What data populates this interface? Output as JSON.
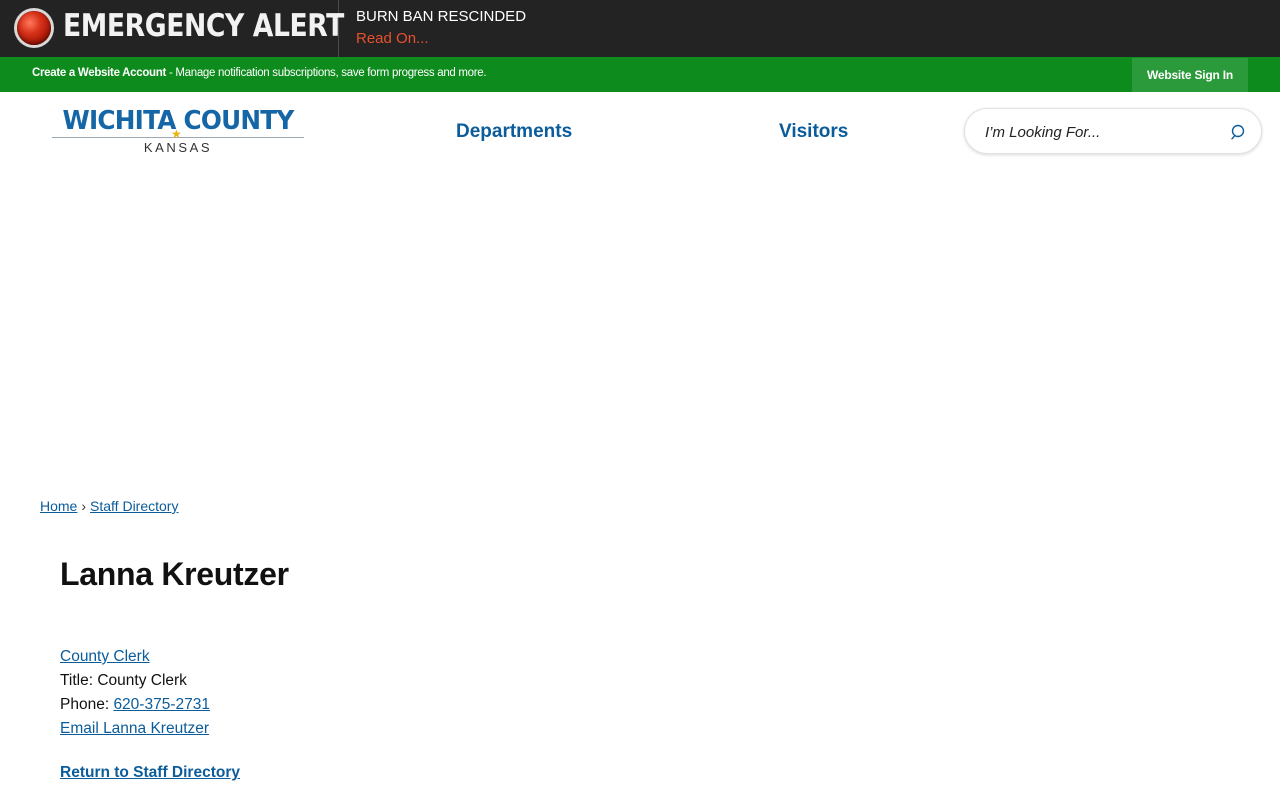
{
  "alert": {
    "title": "EMERGENCY ALERT",
    "headline": "BURN BAN RESCINDED",
    "read_on": "Read On..."
  },
  "account_bar": {
    "create_account_label": "Create a Website Account",
    "description": " - Manage notification subscriptions, save form progress and more.",
    "sign_in_label": "Website Sign In"
  },
  "header": {
    "logo_main": "WICHITA COUNTY",
    "logo_sub": "KANSAS",
    "nav": [
      {
        "label": "Departments"
      },
      {
        "label": "Visitors"
      }
    ],
    "search_placeholder": "I’m Looking For...",
    "icons": {
      "search": "search-icon",
      "alert": "alert-light-icon",
      "logo_star": "star-icon"
    }
  },
  "breadcrumb": {
    "items": [
      {
        "label": "Home"
      },
      {
        "label": "Staff Directory"
      }
    ],
    "separator": "›"
  },
  "staff": {
    "name": "Lanna Kreutzer",
    "department": "County Clerk",
    "title_label": "Title: ",
    "title": "County Clerk",
    "phone_label": "Phone: ",
    "phone": "620-375-2731",
    "email_label": "Email Lanna Kreutzer"
  },
  "return_link": "Return to Staff Directory",
  "colors": {
    "alert_bg": "#232323",
    "alert_link": "#e8502e",
    "account_bar_bg": "#0e8b1d",
    "sign_in_bg": "#2a9a3a",
    "brand_blue": "#1566a6",
    "link_blue": "#0b5c9b",
    "logo_star": "#e5b410"
  }
}
